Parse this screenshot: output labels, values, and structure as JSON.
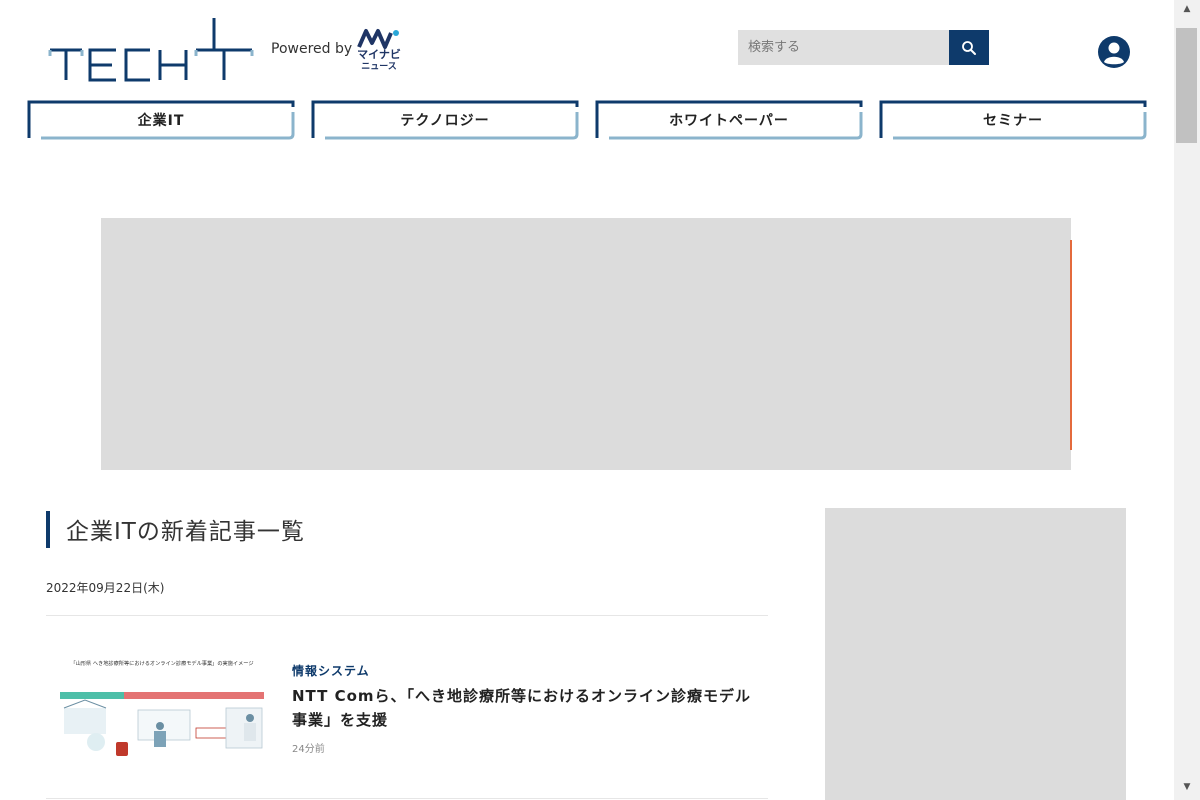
{
  "header": {
    "logo_text": "TECH+",
    "powered_by": "Powered by",
    "partner_logo_name": "マイナビ",
    "partner_logo_sub": "ニュース",
    "search_placeholder": "検索する",
    "search_icon": "search-icon",
    "user_icon": "user-icon"
  },
  "nav": {
    "items": [
      {
        "label": "企業IT"
      },
      {
        "label": "テクノロジー"
      },
      {
        "label": "ホワイトペーパー"
      },
      {
        "label": "セミナー"
      }
    ]
  },
  "section": {
    "title": "企業ITの新着記事一覧",
    "date": "2022年09月22日(木)"
  },
  "articles": [
    {
      "category": "情報システム",
      "title": "NTT Comら、「へき地診療所等におけるオンライン診療モデル事業」を支援",
      "time": "24分前",
      "thumb_caption": "「山形県 へき地診療所等におけるオンライン診療モデル事業」の実施イメージ"
    }
  ],
  "colors": {
    "brand_navy": "#0e3a6b",
    "nav_light": "#8bb4cc",
    "ad_gray": "#dcdcdc"
  }
}
